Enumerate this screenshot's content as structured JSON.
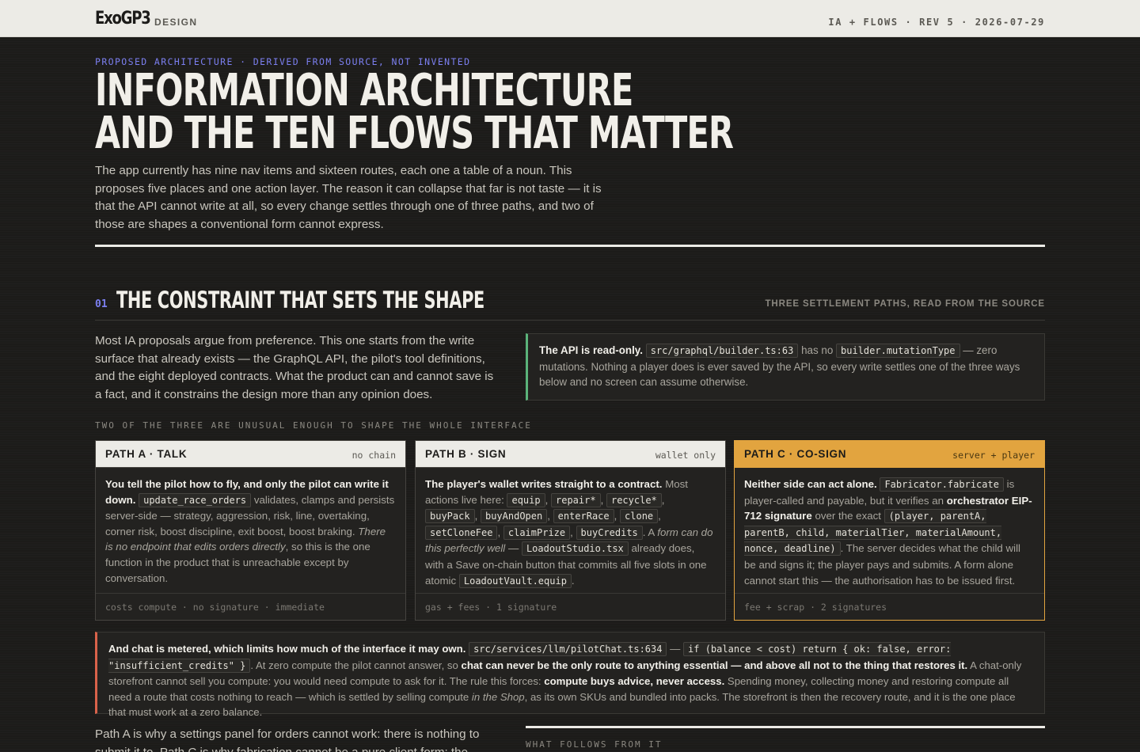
{
  "header": {
    "brand": "ExoGP3",
    "brand_sub": "DESIGN",
    "revision": "IA + FLOWS · REV 5 · 2026-07-29"
  },
  "hero": {
    "eyebrow": "PROPOSED ARCHITECTURE · DERIVED FROM SOURCE, NOT INVENTED",
    "title_line1": "Information Architecture",
    "title_line2": "and the Ten Flows That Matter",
    "lede": "The app currently has nine nav items and sixteen routes, each one a table of a noun. This proposes five places and one action layer. The reason it can collapse that far is not taste — it is that the API cannot write at all, so every change settles through one of three paths, and two of those are shapes a conventional form cannot express."
  },
  "section": {
    "number": "01",
    "title": "The Constraint That Sets the Shape",
    "aside": "THREE SETTLEMENT PATHS, READ FROM THE SOURCE",
    "intro": "Most IA proposals argue from preference. This one starts from the write surface that already exists — the GraphQL API, the pilot's tool definitions, and the eight deployed contracts. What the product can and cannot save is a fact, and it constrains the design more than any opinion does.",
    "callout": {
      "lead": "The API is read-only.",
      "code1": "src/graphql/builder.ts:63",
      "mid": "has no",
      "code2": "builder.mutationType",
      "tail": "— zero mutations. Nothing a player does is ever saved by the API, so every write settles one of the three ways below and no screen can assume otherwise."
    },
    "group_label": "TWO OF THE THREE ARE UNUSUAL ENOUGH TO SHAPE THE WHOLE INTERFACE"
  },
  "paths": [
    {
      "title": "PATH A · TALK",
      "tag": "no chain",
      "lead": "You tell the pilot how to fly, and only the pilot can write it down.",
      "code": "update_race_orders",
      "text1": "validates, clamps and persists server-side — strategy, aggression, risk, line, overtaking, corner risk, boost discipline, exit boost, boost braking.",
      "italic": "There is no endpoint that edits orders directly",
      "text2": ", so this is the one function in the product that is unreachable except by conversation.",
      "footer": "costs compute · no signature · immediate"
    },
    {
      "title": "PATH B · SIGN",
      "tag": "wallet only",
      "lead": "The player's wallet writes straight to a contract.",
      "text1": "Most actions live here:",
      "codes": [
        "equip",
        "repair*",
        "recycle*",
        "buyPack",
        "buyAndOpen",
        "enterRace",
        "clone",
        "setCloneFee",
        "claimPrize",
        "buyCredits"
      ],
      "text2": ". A",
      "italic": "form can do this perfectly well",
      "text3": "—",
      "code_a": "LoadoutStudio.tsx",
      "text4": "already does, with a Save on-chain button that commits all five slots in one atomic",
      "code_b": "LoadoutVault.equip",
      "text5": ".",
      "footer": "gas + fees · 1 signature"
    },
    {
      "title": "PATH C · CO-SIGN",
      "tag": "server + player",
      "lead": "Neither side can act alone.",
      "code1": "Fabricator.fabricate",
      "text1": "is player-called and payable, but it verifies an",
      "bold": "orchestrator EIP-712 signature",
      "text2": "over the exact",
      "code2": "(player, parentA, parentB, child, materialTier, materialAmount, nonce, deadline)",
      "text3": ". The server decides what the child will be and signs it; the player pays and submits. A form alone cannot start this — the authorisation has to be issued first.",
      "footer": "fee + scrap · 2 signatures"
    }
  ],
  "metered": {
    "lead": "And chat is metered, which limits how much of the interface it may own.",
    "code1": "src/services/llm/pilotChat.ts:634",
    "dash": "—",
    "code2": "if (balance < cost) return { ok: false, error: \"insufficient_credits\" }",
    "text1": ". At zero compute the pilot cannot answer, so",
    "bold1": "chat can never be the only route to anything essential — and above all not to the thing that restores it.",
    "text2": "A chat-only storefront cannot sell you compute: you would need compute to ask for it. The rule this forces:",
    "bold2": "compute buys advice, never access.",
    "text3": "Spending money, collecting money and restoring compute all need a route that costs nothing to reach — which is settled by selling compute",
    "italic": "in the Shop",
    "text4": ", as its own SKUs and bundled into packs. The storefront is then the recovery route, and it is the one place that must work at a zero balance."
  },
  "outro": "Path A is why a settings panel for orders cannot work: there is nothing to submit it to. Path C is why fabrication cannot be a pure client form: the",
  "follow_label": "WHAT FOLLOWS FROM IT"
}
